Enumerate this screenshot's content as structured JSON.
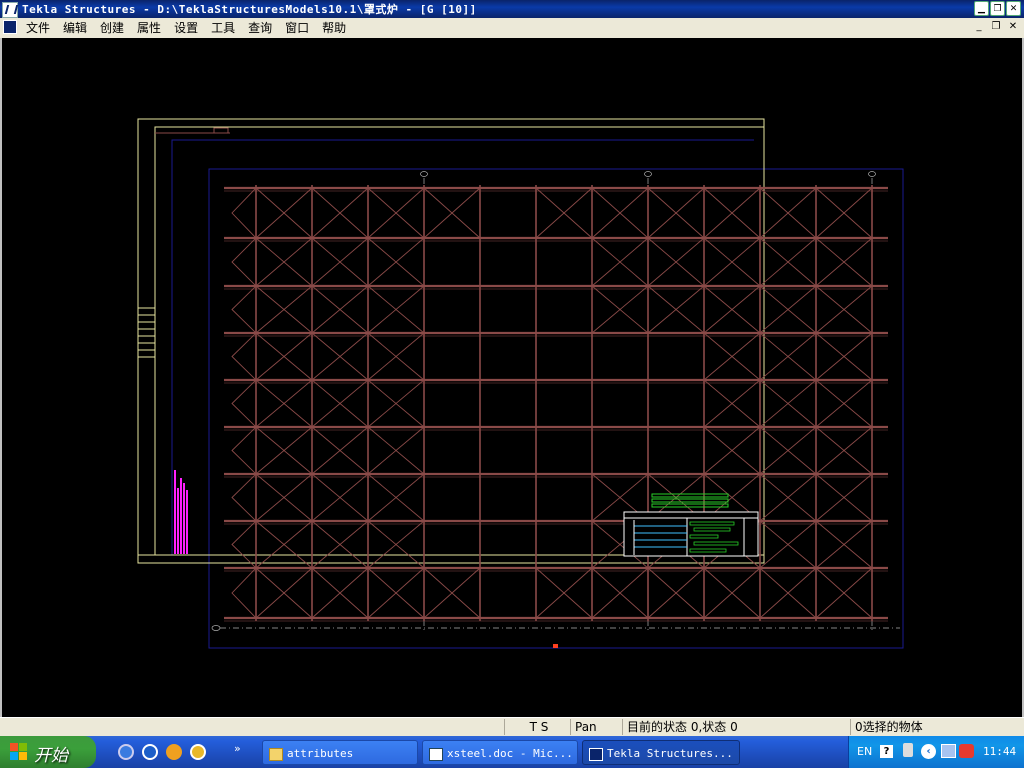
{
  "window": {
    "title": "Tekla Structures - D:\\TeklaStructuresModels10.1\\罩式炉 - [G    [10]]",
    "icons": {
      "app": "tekla-app-icon",
      "min": "minimize-icon",
      "max": "maximize-icon",
      "close": "close-icon"
    }
  },
  "menubar": {
    "items": [
      "文件",
      "编辑",
      "创建",
      "属性",
      "设置",
      "工具",
      "查询",
      "窗口",
      "帮助"
    ],
    "mdi": {
      "min": "_",
      "restore": "❐",
      "close": "✕"
    }
  },
  "drawing": {
    "colors": {
      "frame": "#e8e6a0",
      "sheet": "#1a1a90",
      "members": "#8a4a48",
      "gridlines": "#b0b0b0",
      "title_table": "#ffffff",
      "green_parts": "#27d027",
      "magenta_parts": "#ff20ff",
      "cyan_rows": "#40c0ff"
    }
  },
  "statusbar": {
    "ts": "T S",
    "mode": "Pan",
    "state": "目前的状态 0,状态 0",
    "selection": "0选择的物体"
  },
  "taskbar": {
    "start": "开始",
    "more": "»",
    "tasks": [
      {
        "label": "attributes",
        "icon": "folder-icon"
      },
      {
        "label": "xsteel.doc - Mic...",
        "icon": "word-icon"
      },
      {
        "label": "Tekla Structures...",
        "icon": "tekla-icon"
      }
    ],
    "tray": {
      "lang": "EN",
      "help": "?",
      "chevron": "‹",
      "clock": "11:44"
    }
  }
}
